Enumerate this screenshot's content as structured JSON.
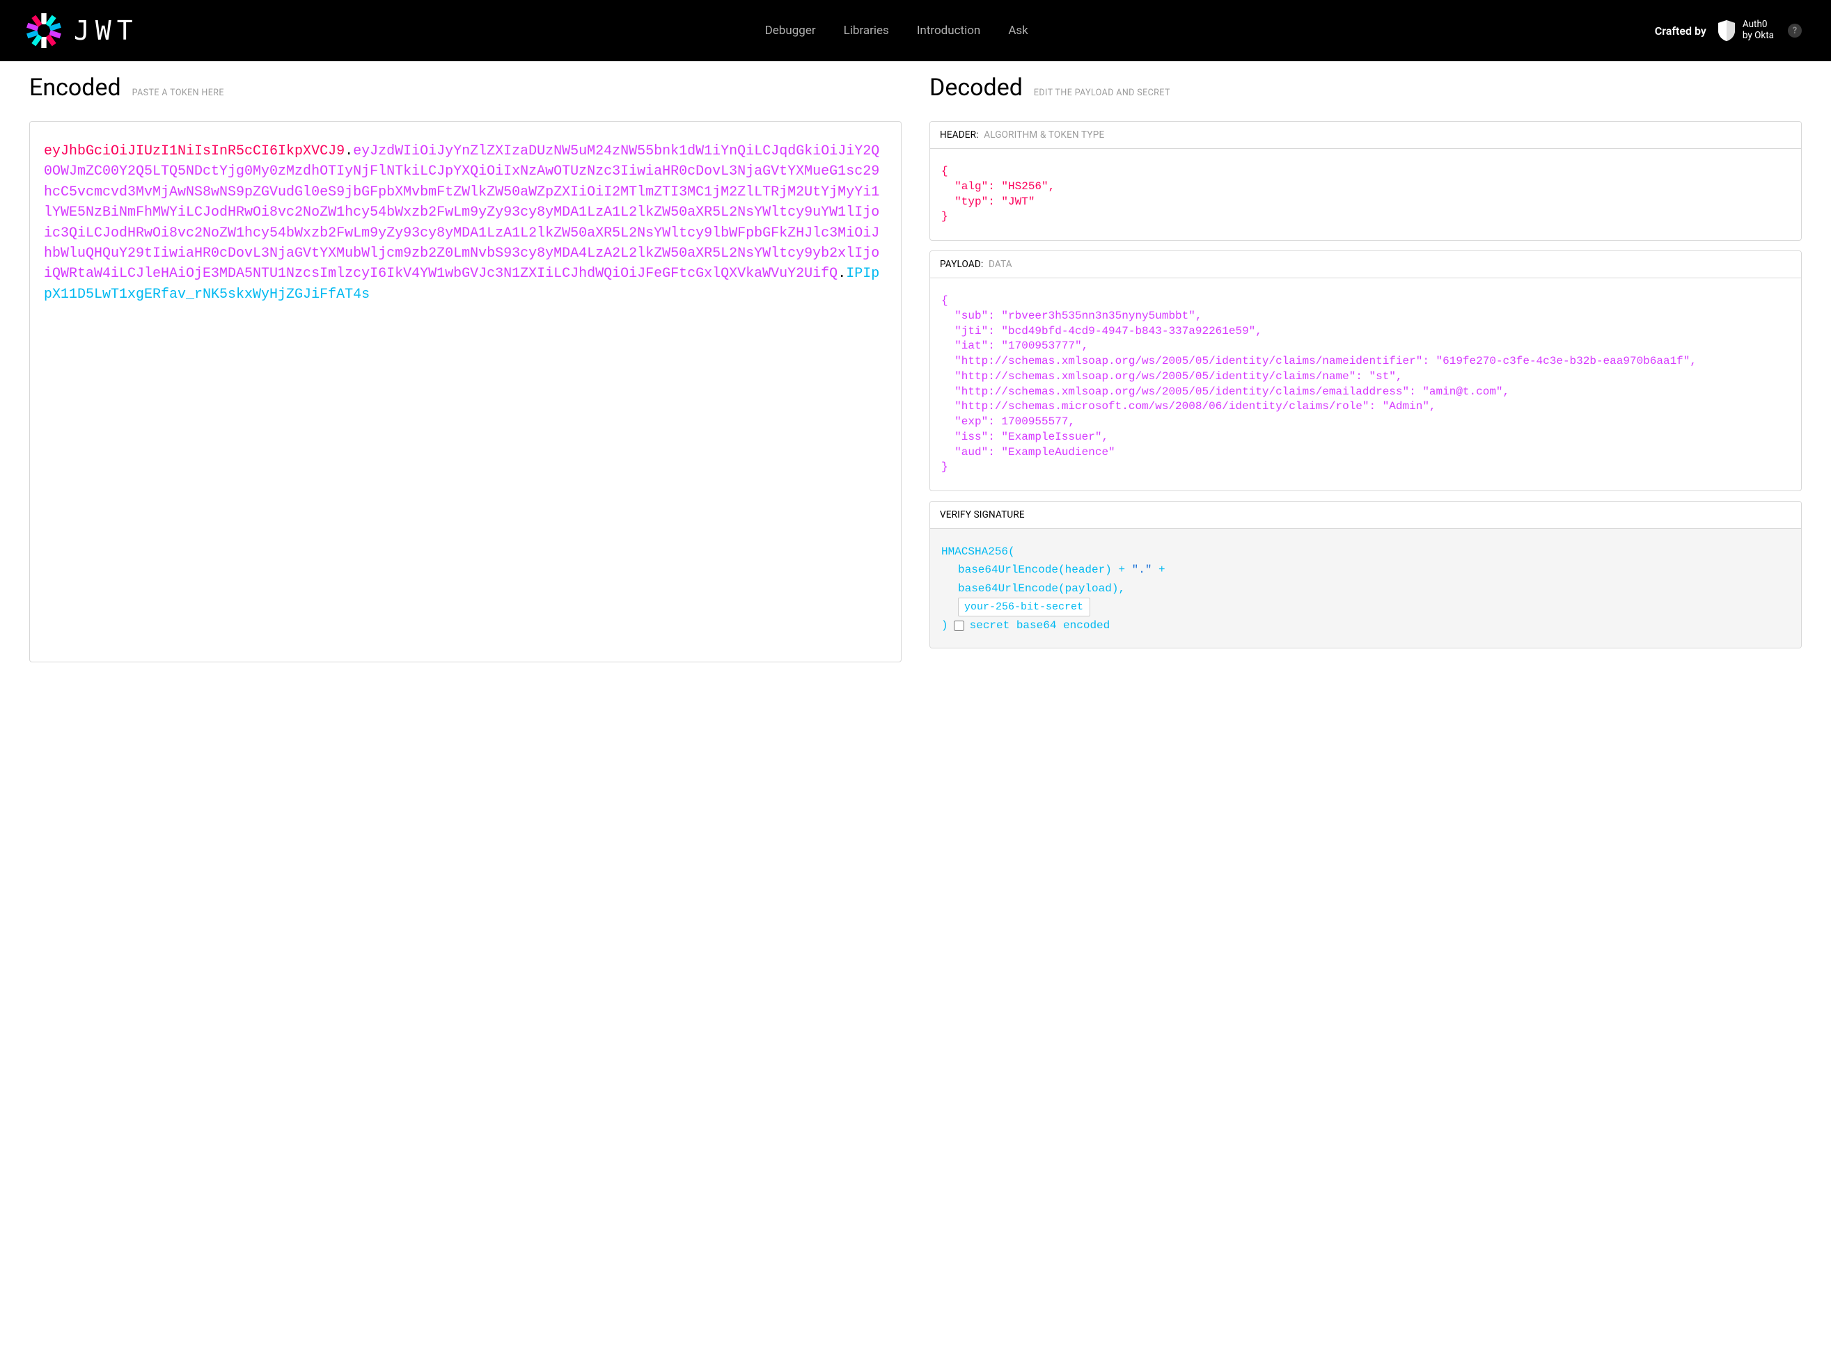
{
  "nav": {
    "links": [
      "Debugger",
      "Libraries",
      "Introduction",
      "Ask"
    ],
    "crafted_by": "Crafted by",
    "auth0_line1": "Auth0",
    "auth0_line2": "by Okta",
    "help": "?"
  },
  "encoded": {
    "title": "Encoded",
    "subtitle": "PASTE A TOKEN HERE",
    "token": {
      "header": "eyJhbGciOiJIUzI1NiIsInR5cCI6IkpXVCJ9",
      "payload": "eyJzdWIiOiJyYnZlZXIzaDUzNW5uM24zNW55bnk1dW1iYnQiLCJqdGkiOiJiY2Q0OWJmZC00Y2Q5LTQ5NDctYjg0My0zMzdhOTIyNjFlNTkiLCJpYXQiOiIxNzAwOTUzNzc3IiwiaHR0cDovL3NjaGVtYXMueG1sc29hcC5vcmcvd3MvMjAwNS8wNS9pZGVudGl0eS9jbGFpbXMvbmFtZWlkZW50aWZpZXIiOiI2MTlmZTI3MC1jM2ZlLTRjM2UtYjMyYi1lYWE5NzBiNmFhMWYiLCJodHRwOi8vc2NoZW1hcy54bWxzb2FwLm9yZy93cy8yMDA1LzA1L2lkZW50aXR5L2NsYWltcy9uYW1lIjoic3QiLCJodHRwOi8vc2NoZW1hcy54bWxzb2FwLm9yZy93cy8yMDA1LzA1L2lkZW50aXR5L2NsYWltcy9lbWFpbGFkZHJlc3MiOiJhbWluQHQuY29tIiwiaHR0cDovL3NjaGVtYXMubWljcm9zb2Z0LmNvbS93cy8yMDA4LzA2L2lkZW50aXR5L2NsYWltcy9yb2xlIjoiQWRtaW4iLCJleHAiOjE3MDA5NTU1NzcsImlzcyI6IkV4YW1wbGVJc3N1ZXIiLCJhdWQiOiJFeGFtcGxlQXVkaWVuY2UifQ",
      "signature": "IPIppX11D5LwT1xgERfav_rNK5skxWyHjZGJiFfAT4s"
    }
  },
  "decoded": {
    "title": "Decoded",
    "subtitle": "EDIT THE PAYLOAD AND SECRET",
    "header_section": {
      "label": "HEADER:",
      "sublabel": "ALGORITHM & TOKEN TYPE",
      "json": "{\n  \"alg\": \"HS256\",\n  \"typ\": \"JWT\"\n}"
    },
    "payload_section": {
      "label": "PAYLOAD:",
      "sublabel": "DATA",
      "json": "{\n  \"sub\": \"rbveer3h535nn3n35nyny5umbbt\",\n  \"jti\": \"bcd49bfd-4cd9-4947-b843-337a92261e59\",\n  \"iat\": \"1700953777\",\n  \"http://schemas.xmlsoap.org/ws/2005/05/identity/claims/nameidentifier\": \"619fe270-c3fe-4c3e-b32b-eaa970b6aa1f\",\n  \"http://schemas.xmlsoap.org/ws/2005/05/identity/claims/name\": \"st\",\n  \"http://schemas.xmlsoap.org/ws/2005/05/identity/claims/emailaddress\": \"amin@t.com\",\n  \"http://schemas.microsoft.com/ws/2008/06/identity/claims/role\": \"Admin\",\n  \"exp\": 1700955577,\n  \"iss\": \"ExampleIssuer\",\n  \"aud\": \"ExampleAudience\"\n}"
    },
    "signature_section": {
      "label": "VERIFY SIGNATURE",
      "line1": "HMACSHA256(",
      "line2_a": "base64UrlEncode(header) + ",
      "line2_b": "\".\"",
      "line2_c": " +",
      "line3": "base64UrlEncode(payload),",
      "secret_placeholder": "your-256-bit-secret",
      "close_paren": ")",
      "checkbox_label": "secret base64 encoded"
    }
  }
}
